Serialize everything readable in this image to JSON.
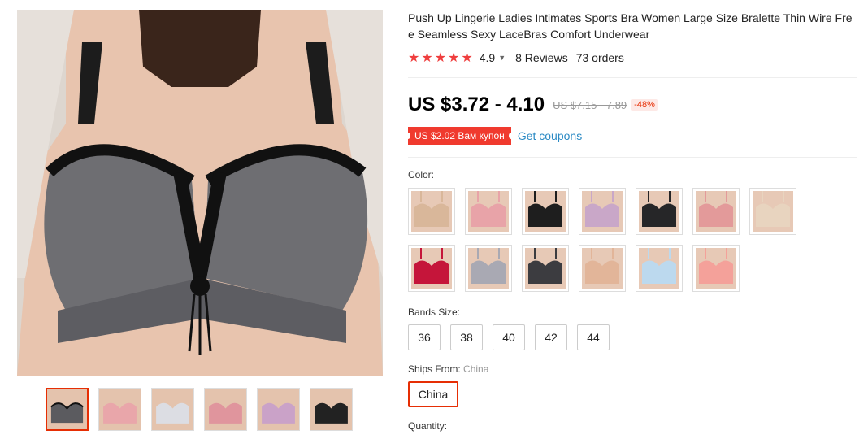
{
  "product": {
    "title": "Push Up Lingerie Ladies Intimates Sports Bra Women Large Size Bralette Thin Wire Free Seamless Sexy LaceBras Comfort Underwear",
    "rating": "4.9",
    "reviews": "8 Reviews",
    "orders": "73 orders",
    "price": "US $3.72 - 4.10",
    "old_price": "US $7.15 - 7.89",
    "discount": "-48%",
    "coupon": "US $2.02 Вам купон",
    "get_coupons": "Get coupons"
  },
  "color": {
    "label": "Color:",
    "swatches": [
      {
        "name": "nude",
        "color": "#d9b79a"
      },
      {
        "name": "pink",
        "color": "#e8a3a8"
      },
      {
        "name": "black",
        "color": "#1e1e1e"
      },
      {
        "name": "lilac",
        "color": "#c9a7c8"
      },
      {
        "name": "black-2",
        "color": "#262628"
      },
      {
        "name": "rose",
        "color": "#e39a9a"
      },
      {
        "name": "beige",
        "color": "#e8d4bf"
      },
      {
        "name": "red",
        "color": "#c5153a"
      },
      {
        "name": "gray",
        "color": "#a9a9b3"
      },
      {
        "name": "black-gray",
        "color": "#3c3c40"
      },
      {
        "name": "skin",
        "color": "#e2b599"
      },
      {
        "name": "light-blue",
        "color": "#bcd9ee"
      },
      {
        "name": "coral",
        "color": "#f4a19a"
      }
    ]
  },
  "bands": {
    "label": "Bands Size:",
    "options": [
      "36",
      "38",
      "40",
      "42",
      "44"
    ]
  },
  "ships": {
    "label": "Ships From:",
    "selected_label": "China",
    "option": "China"
  },
  "quantity": {
    "label": "Quantity:"
  },
  "gallery": {
    "main_color": "#6e6e72",
    "thumbs": [
      {
        "name": "gray",
        "color": "#5b5b5f"
      },
      {
        "name": "pink",
        "color": "#e9a6aa"
      },
      {
        "name": "white",
        "color": "#dcdde3"
      },
      {
        "name": "rose",
        "color": "#e0959d"
      },
      {
        "name": "lilac",
        "color": "#caa2c8"
      },
      {
        "name": "black",
        "color": "#222"
      }
    ]
  }
}
